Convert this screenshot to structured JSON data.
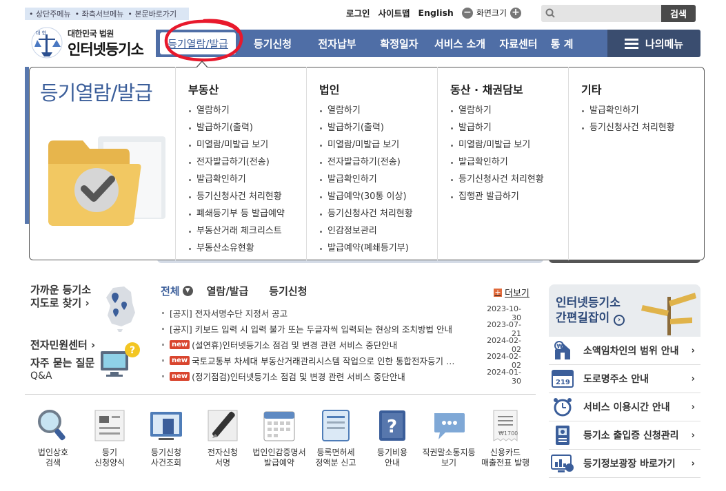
{
  "skip_links": [
    "상단주메뉴",
    "좌측서브메뉴",
    "본문바로가기"
  ],
  "util": {
    "login": "로그인",
    "sitemap": "사이트맵",
    "english": "English",
    "zoom": "화면크기"
  },
  "search": {
    "placeholder": "",
    "button": "검색"
  },
  "logo": {
    "court": "대한민국 법원",
    "name": "인터넷등기소"
  },
  "nav": {
    "items": [
      "등기열람/발급",
      "등기신청",
      "전자납부",
      "확정일자",
      "서비스 소개",
      "자료센터",
      "통 계"
    ],
    "my_menu": "나의메뉴"
  },
  "panel": {
    "title": "등기열람/발급",
    "columns": [
      {
        "heading": "부동산",
        "links": [
          "열람하기",
          "발급하기(출력)",
          "미열람/미발급 보기",
          "전자발급하기(전송)",
          "발급확인하기",
          "등기신청사건 처리현황",
          "폐쇄등기부 등 발급예약",
          "부동산거래 체크리스트",
          "부동산소유현황"
        ]
      },
      {
        "heading": "법인",
        "links": [
          "열람하기",
          "발급하기(출력)",
          "미열람/미발급 보기",
          "전자발급하기(전송)",
          "발급확인하기",
          "발급예약(30통 이상)",
          "등기신청사건 처리현황",
          "인감정보관리",
          "발급예약(폐쇄등기부)"
        ]
      },
      {
        "heading": "동산 · 채권담보",
        "links": [
          "열람하기",
          "발급하기",
          "미열람/미발급 보기",
          "발급확인하기",
          "등기신청사건 처리현황",
          "집행관 발급하기"
        ]
      },
      {
        "heading": "기타",
        "links": [
          "발급확인하기",
          "등기신청사건 처리현황"
        ]
      }
    ]
  },
  "left": {
    "map_line1": "가까운 등기소",
    "map_line2": "지도로 찾기",
    "civil": "전자민원센터",
    "faq_line1": "자주 묻는 질문",
    "faq_line2": "Q&A"
  },
  "notices": {
    "tabs": [
      "전체",
      "열람/발급",
      "등기신청"
    ],
    "more": "더보기",
    "new_label": "new",
    "items": [
      {
        "new": false,
        "text": "[공지] 전자서명수단 지정서 공고",
        "date": "2023-10-30"
      },
      {
        "new": false,
        "text": "[공지] 키보드 입력 시 입력 불가 또는 두글자씩 입력되는 현상의 조치방법 안내",
        "date": "2023-07-21"
      },
      {
        "new": true,
        "text": "(설연휴)인터넷등기소 점검 및 변경 관련 서비스 중단안내",
        "date": "2024-02-02"
      },
      {
        "new": true,
        "text": "국토교통부 차세대 부동산거래관리시스템 작업으로 인한 통합전자등기 …",
        "date": "2024-02-02"
      },
      {
        "new": true,
        "text": "(정기점검)인터넷등기소 점검 및 변경 관련 서비스 중단안내",
        "date": "2024-01-30"
      }
    ]
  },
  "quick_icons": [
    {
      "l1": "법인상호",
      "l2": "검색",
      "icon": "magnifier-icon"
    },
    {
      "l1": "등기",
      "l2": "신청양식",
      "icon": "form-icon"
    },
    {
      "l1": "등기신청",
      "l2": "사건조회",
      "icon": "monitor-icon"
    },
    {
      "l1": "전자신청",
      "l2": "서명",
      "icon": "pen-icon"
    },
    {
      "l1": "법인인감증명서",
      "l2": "발급예약",
      "icon": "calendar-icon"
    },
    {
      "l1": "등록면허세",
      "l2": "정액분 신고",
      "icon": "document-icon"
    },
    {
      "l1": "등기비용",
      "l2": "안내",
      "icon": "question-book-icon"
    },
    {
      "l1": "직권말소통지등",
      "l2": "보기",
      "icon": "speech-bubble-icon"
    },
    {
      "l1": "신용카드",
      "l2": "매출전표 발행",
      "icon": "receipt-icon"
    }
  ],
  "right": {
    "banner_l1": "인터넷등기소",
    "banner_l2": "간편길잡이",
    "items": [
      {
        "label": "소액임차인의 범위 안내",
        "icon": "house-money-icon"
      },
      {
        "label": "도로명주소 안내",
        "icon": "address-sign-icon"
      },
      {
        "label": "서비스 이용시간 안내",
        "icon": "alarm-clock-icon"
      },
      {
        "label": "등기소 출입증 신청관리",
        "icon": "id-card-icon"
      },
      {
        "label": "등기정보광장 바로가기",
        "icon": "chart-monitor-icon"
      }
    ]
  },
  "colors": {
    "nav": "#4f6ea6",
    "accent": "#3b5e9a",
    "new_badge": "#d9452e",
    "highlight_circle": "#e8192c"
  }
}
